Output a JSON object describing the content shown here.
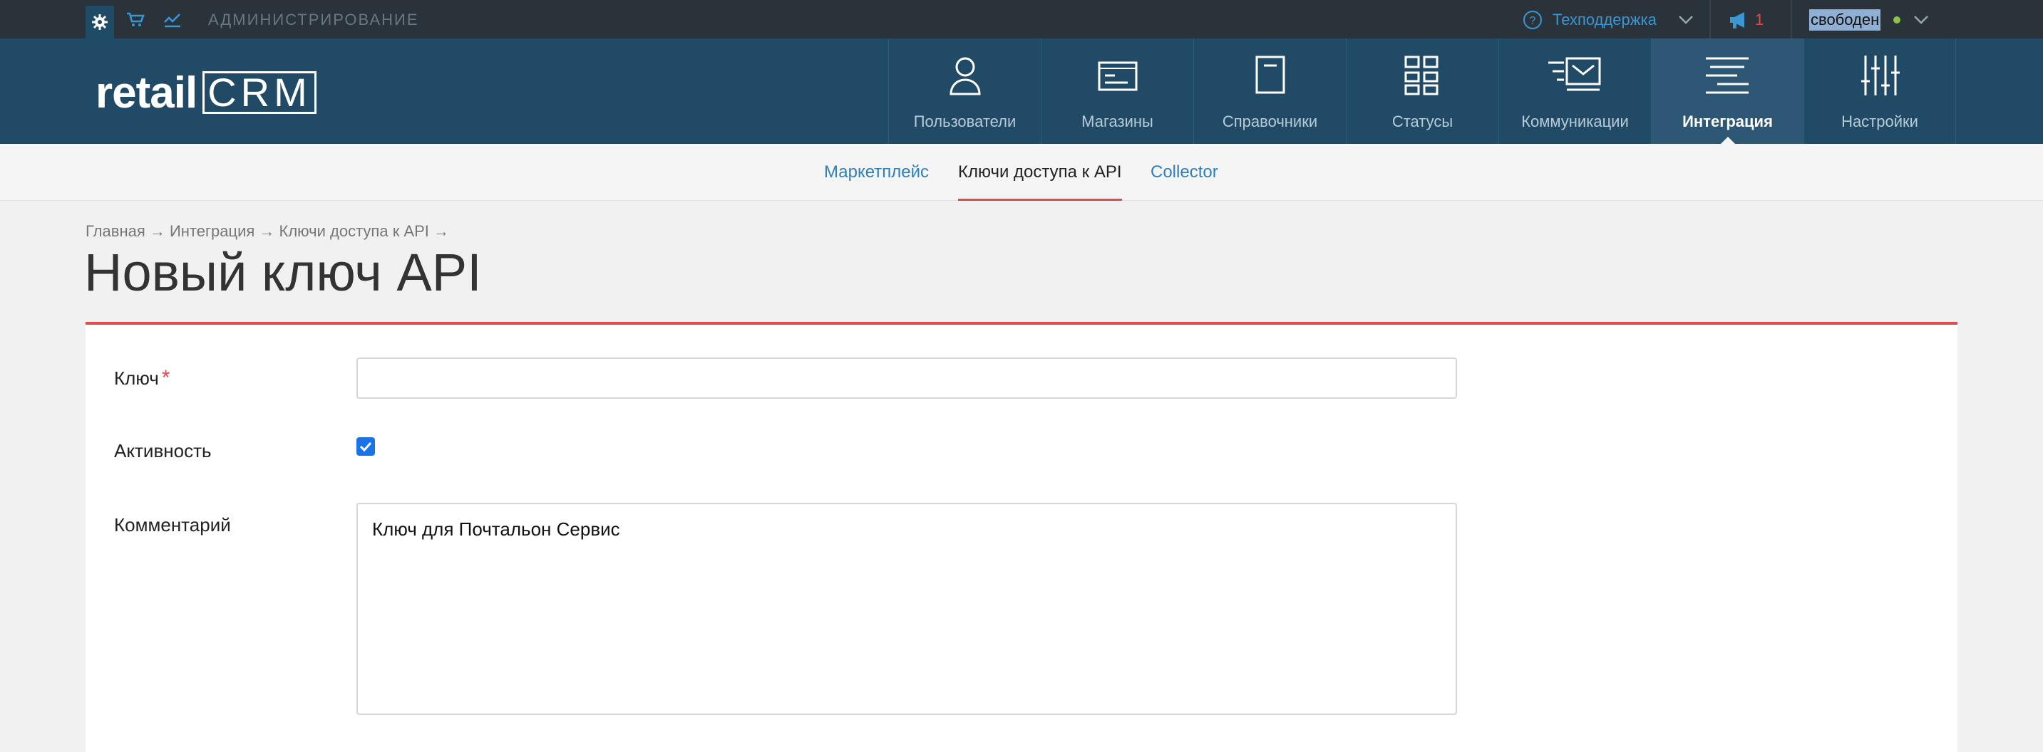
{
  "topbar": {
    "admin_label": "АДМИНИСТРИРОВАНИЕ",
    "support_label": "Техподдержка",
    "notifications_count": "1",
    "status_label": "свободен"
  },
  "logo": {
    "text_retail": "retail",
    "text_crm": "CRM"
  },
  "nav": {
    "items": [
      {
        "label": "Пользователи",
        "icon": "user-icon"
      },
      {
        "label": "Магазины",
        "icon": "store-icon"
      },
      {
        "label": "Справочники",
        "icon": "reference-icon"
      },
      {
        "label": "Статусы",
        "icon": "statuses-icon"
      },
      {
        "label": "Коммуникации",
        "icon": "communications-icon"
      },
      {
        "label": "Интеграция",
        "icon": "integration-icon",
        "active": true
      },
      {
        "label": "Настройки",
        "icon": "settings-sliders-icon"
      }
    ]
  },
  "subnav": {
    "tabs": [
      {
        "label": "Маркетплейс"
      },
      {
        "label": "Ключи доступа к API",
        "active": true
      },
      {
        "label": "Collector"
      }
    ]
  },
  "breadcrumb": "Главная → Интеграция → Ключи доступа к API →",
  "page_title": "Новый ключ API",
  "form": {
    "key_label": "Ключ",
    "key_value": "",
    "active_label": "Активность",
    "active_checked": true,
    "comment_label": "Комментарий",
    "comment_value": "Ключ для Почтальон Сервис"
  },
  "colors": {
    "topbar_bg": "#2b333a",
    "header_bg": "#214a66",
    "accent_red": "#e24b4b",
    "link_blue": "#2e7fbd"
  }
}
